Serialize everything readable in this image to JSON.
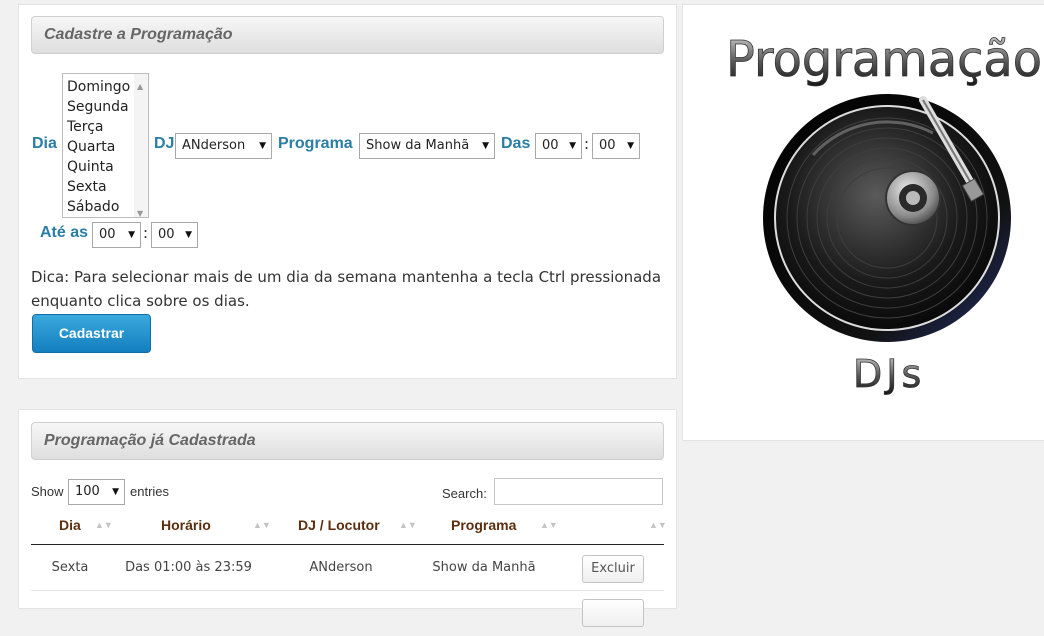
{
  "form_panel": {
    "header": "Cadastre a Programação",
    "day_label": "Dia",
    "days": [
      "Domingo",
      "Segunda",
      "Terça",
      "Quarta",
      "Quinta",
      "Sexta",
      "Sábado"
    ],
    "dj_label": "DJ",
    "dj_value": "ANderson",
    "program_label": "Programa",
    "program_value": "Show da Manhã",
    "from_label": "Das",
    "from_hour": "00",
    "from_min": "00",
    "to_label": "Até as",
    "to_hour": "00",
    "to_min": "00",
    "colon": ":",
    "tip": "Dica: Para selecionar mais de um dia da semana mantenha a tecla Ctrl pressionada enquanto clica sobre os dias.",
    "submit_label": "Cadastrar"
  },
  "list_panel": {
    "header": "Programação já Cadastrada",
    "show_label": "Show",
    "entries_value": "100",
    "entries_label": "entries",
    "search_label": "Search:",
    "search_value": "",
    "columns": [
      "Dia",
      "Horário",
      "DJ / Locutor",
      "Programa"
    ],
    "rows": [
      {
        "dia": "Sexta",
        "horario": "Das 01:00 às 23:59",
        "dj": "ANderson",
        "programa": "Show da Manhã",
        "action": "Excluir"
      }
    ]
  },
  "logo": {
    "title": "Programação",
    "subtitle": "DJs"
  },
  "colors": {
    "accent": "#2a7ea5",
    "button": "#1b8fcf",
    "header_text": "#5c2e0e"
  }
}
